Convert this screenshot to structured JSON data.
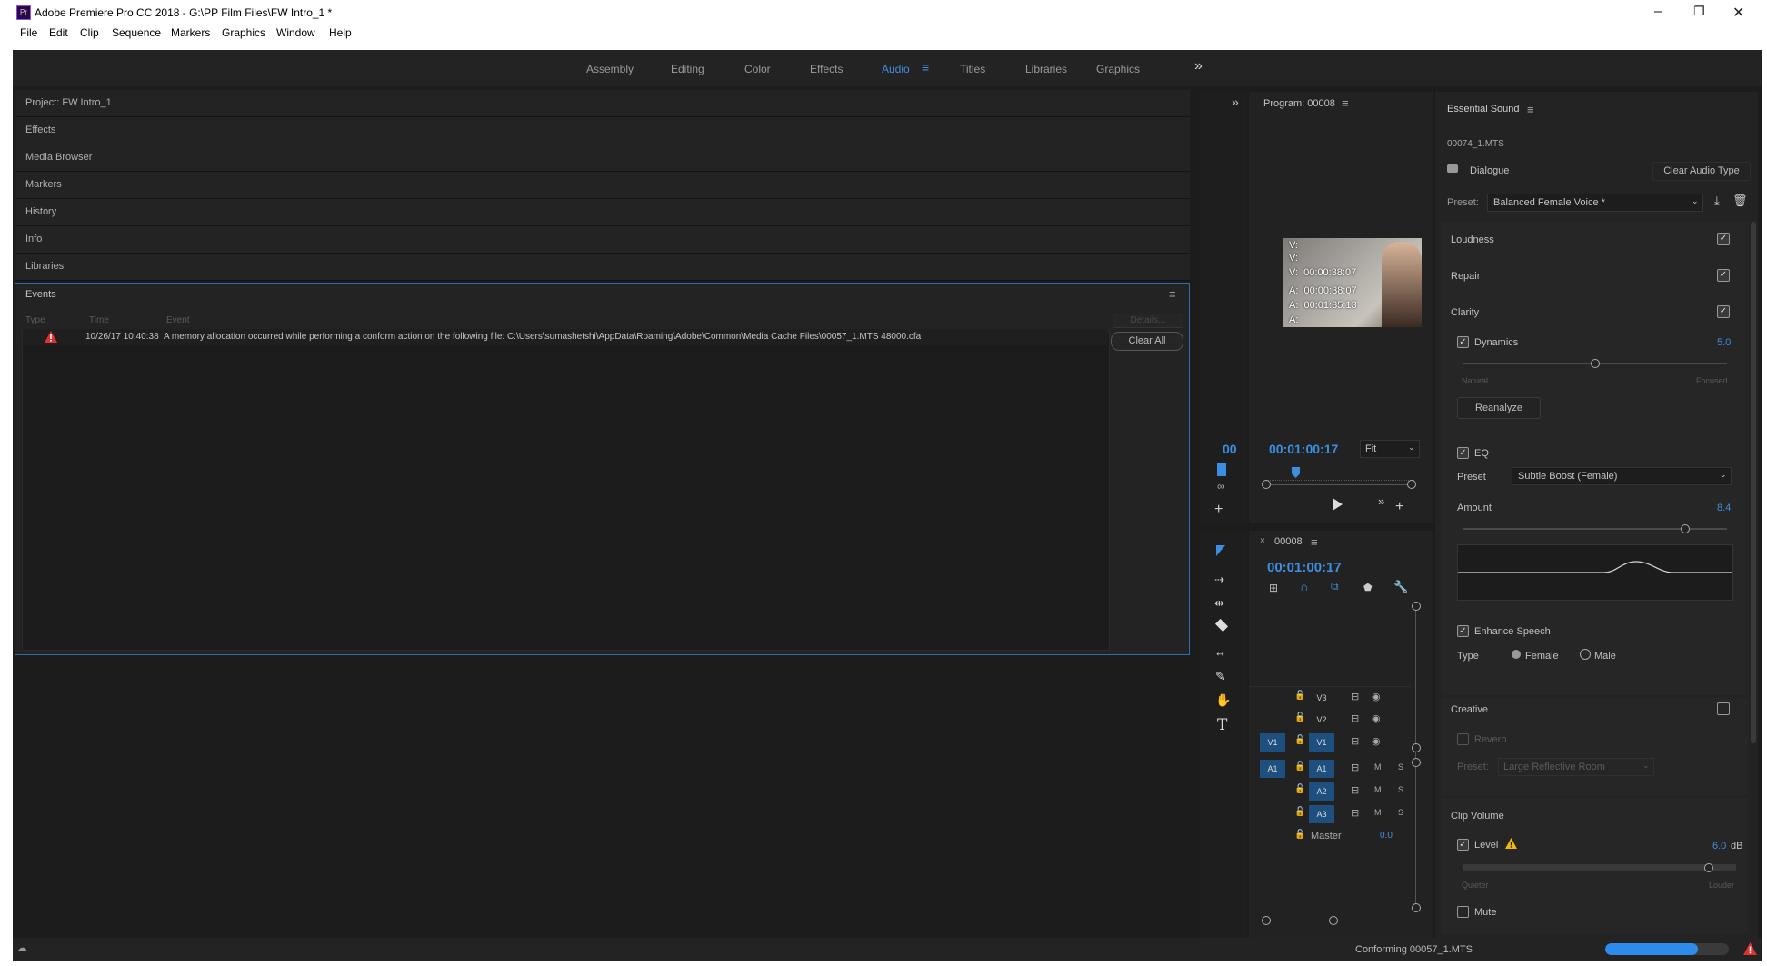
{
  "window": {
    "title": "Adobe Premiere Pro CC 2018 - G:\\PP Film Files\\FW Intro_1 *",
    "app_icon_label": "Pr",
    "minimize": "–",
    "maximize": "❐",
    "close": "✕"
  },
  "menu": [
    "File",
    "Edit",
    "Clip",
    "Sequence",
    "Markers",
    "Graphics",
    "Window",
    "Help"
  ],
  "workspaces": {
    "items": [
      "Assembly",
      "Editing",
      "Color",
      "Effects",
      "Audio",
      "Titles",
      "Libraries",
      "Graphics"
    ],
    "active": "Audio",
    "overflow": "»"
  },
  "left_panels": [
    "Project: FW Intro_1",
    "Effects",
    "Media Browser",
    "Markers",
    "History",
    "Info",
    "Libraries"
  ],
  "events": {
    "title": "Events",
    "columns": [
      "Type",
      "Time",
      "Event"
    ],
    "rows": [
      {
        "time": "10/26/17 10:40:38",
        "message": "A memory allocation occurred while performing a conform action on the following file: C:\\Users\\sumashetshi\\AppData\\Roaming\\Adobe\\Common\\Media Cache Files\\00057_1.MTS 48000.cfa"
      }
    ],
    "details_button": "Details...",
    "clear_all_button": "Clear All"
  },
  "source_monitor": {
    "timecode_fragment": "00"
  },
  "program": {
    "title": "Program: 00008",
    "timecode": "00:01:00:17",
    "fit": "Fit",
    "overlay_lines": [
      "V:",
      "V:",
      "V:  00:00:38:07",
      "A:  00:00:38:07",
      "A:  00:01:35:13",
      "A:"
    ]
  },
  "timeline": {
    "sequence": "00008",
    "timecode": "00:01:00:17",
    "tracks": [
      {
        "src": "",
        "name": "V3",
        "type": "video"
      },
      {
        "src": "",
        "name": "V2",
        "type": "video"
      },
      {
        "src": "V1",
        "name": "V1",
        "type": "video"
      },
      {
        "src": "A1",
        "name": "A1",
        "type": "audio"
      },
      {
        "src": "",
        "name": "A2",
        "type": "audio"
      },
      {
        "src": "",
        "name": "A3",
        "type": "audio"
      }
    ],
    "track_m": "M",
    "track_s": "S",
    "master_label": "Master",
    "master_value": "0.0"
  },
  "essential_sound": {
    "title": "Essential Sound",
    "clip_name": "00074_1.MTS",
    "audio_type": "Dialogue",
    "clear_audio_type": "Clear Audio Type",
    "preset_label": "Preset:",
    "preset_value": "Balanced Female Voice *",
    "loudness": "Loudness",
    "repair": "Repair",
    "clarity": "Clarity",
    "dynamics_label": "Dynamics",
    "dynamics_value": "5.0",
    "dynamics_level": 0.5,
    "natural": "Natural",
    "focused": "Focused",
    "reanalyze": "Reanalyze",
    "eq_label": "EQ",
    "eq_preset_label": "Preset",
    "eq_preset_value": "Subtle Boost (Female)",
    "amount_label": "Amount",
    "amount_value": "8.4",
    "amount_level": 0.84,
    "enhance_speech": "Enhance Speech",
    "type_label": "Type",
    "female": "Female",
    "male": "Male",
    "creative": "Creative",
    "reverb": "Reverb",
    "reverb_preset_label": "Preset:",
    "reverb_preset_value": "Large Reflective Room",
    "clip_volume": "Clip Volume",
    "level_label": "Level",
    "level_value": "6.0",
    "level_unit": "dB",
    "level_fraction": 0.9,
    "quieter": "Quieter",
    "louder": "Louder",
    "mute": "Mute"
  },
  "status": {
    "text": "Conforming 00057_1.MTS",
    "progress": 0.75
  },
  "colors": {
    "accent": "#3d8ee0",
    "panel": "#232323",
    "warning": "#e03030"
  }
}
